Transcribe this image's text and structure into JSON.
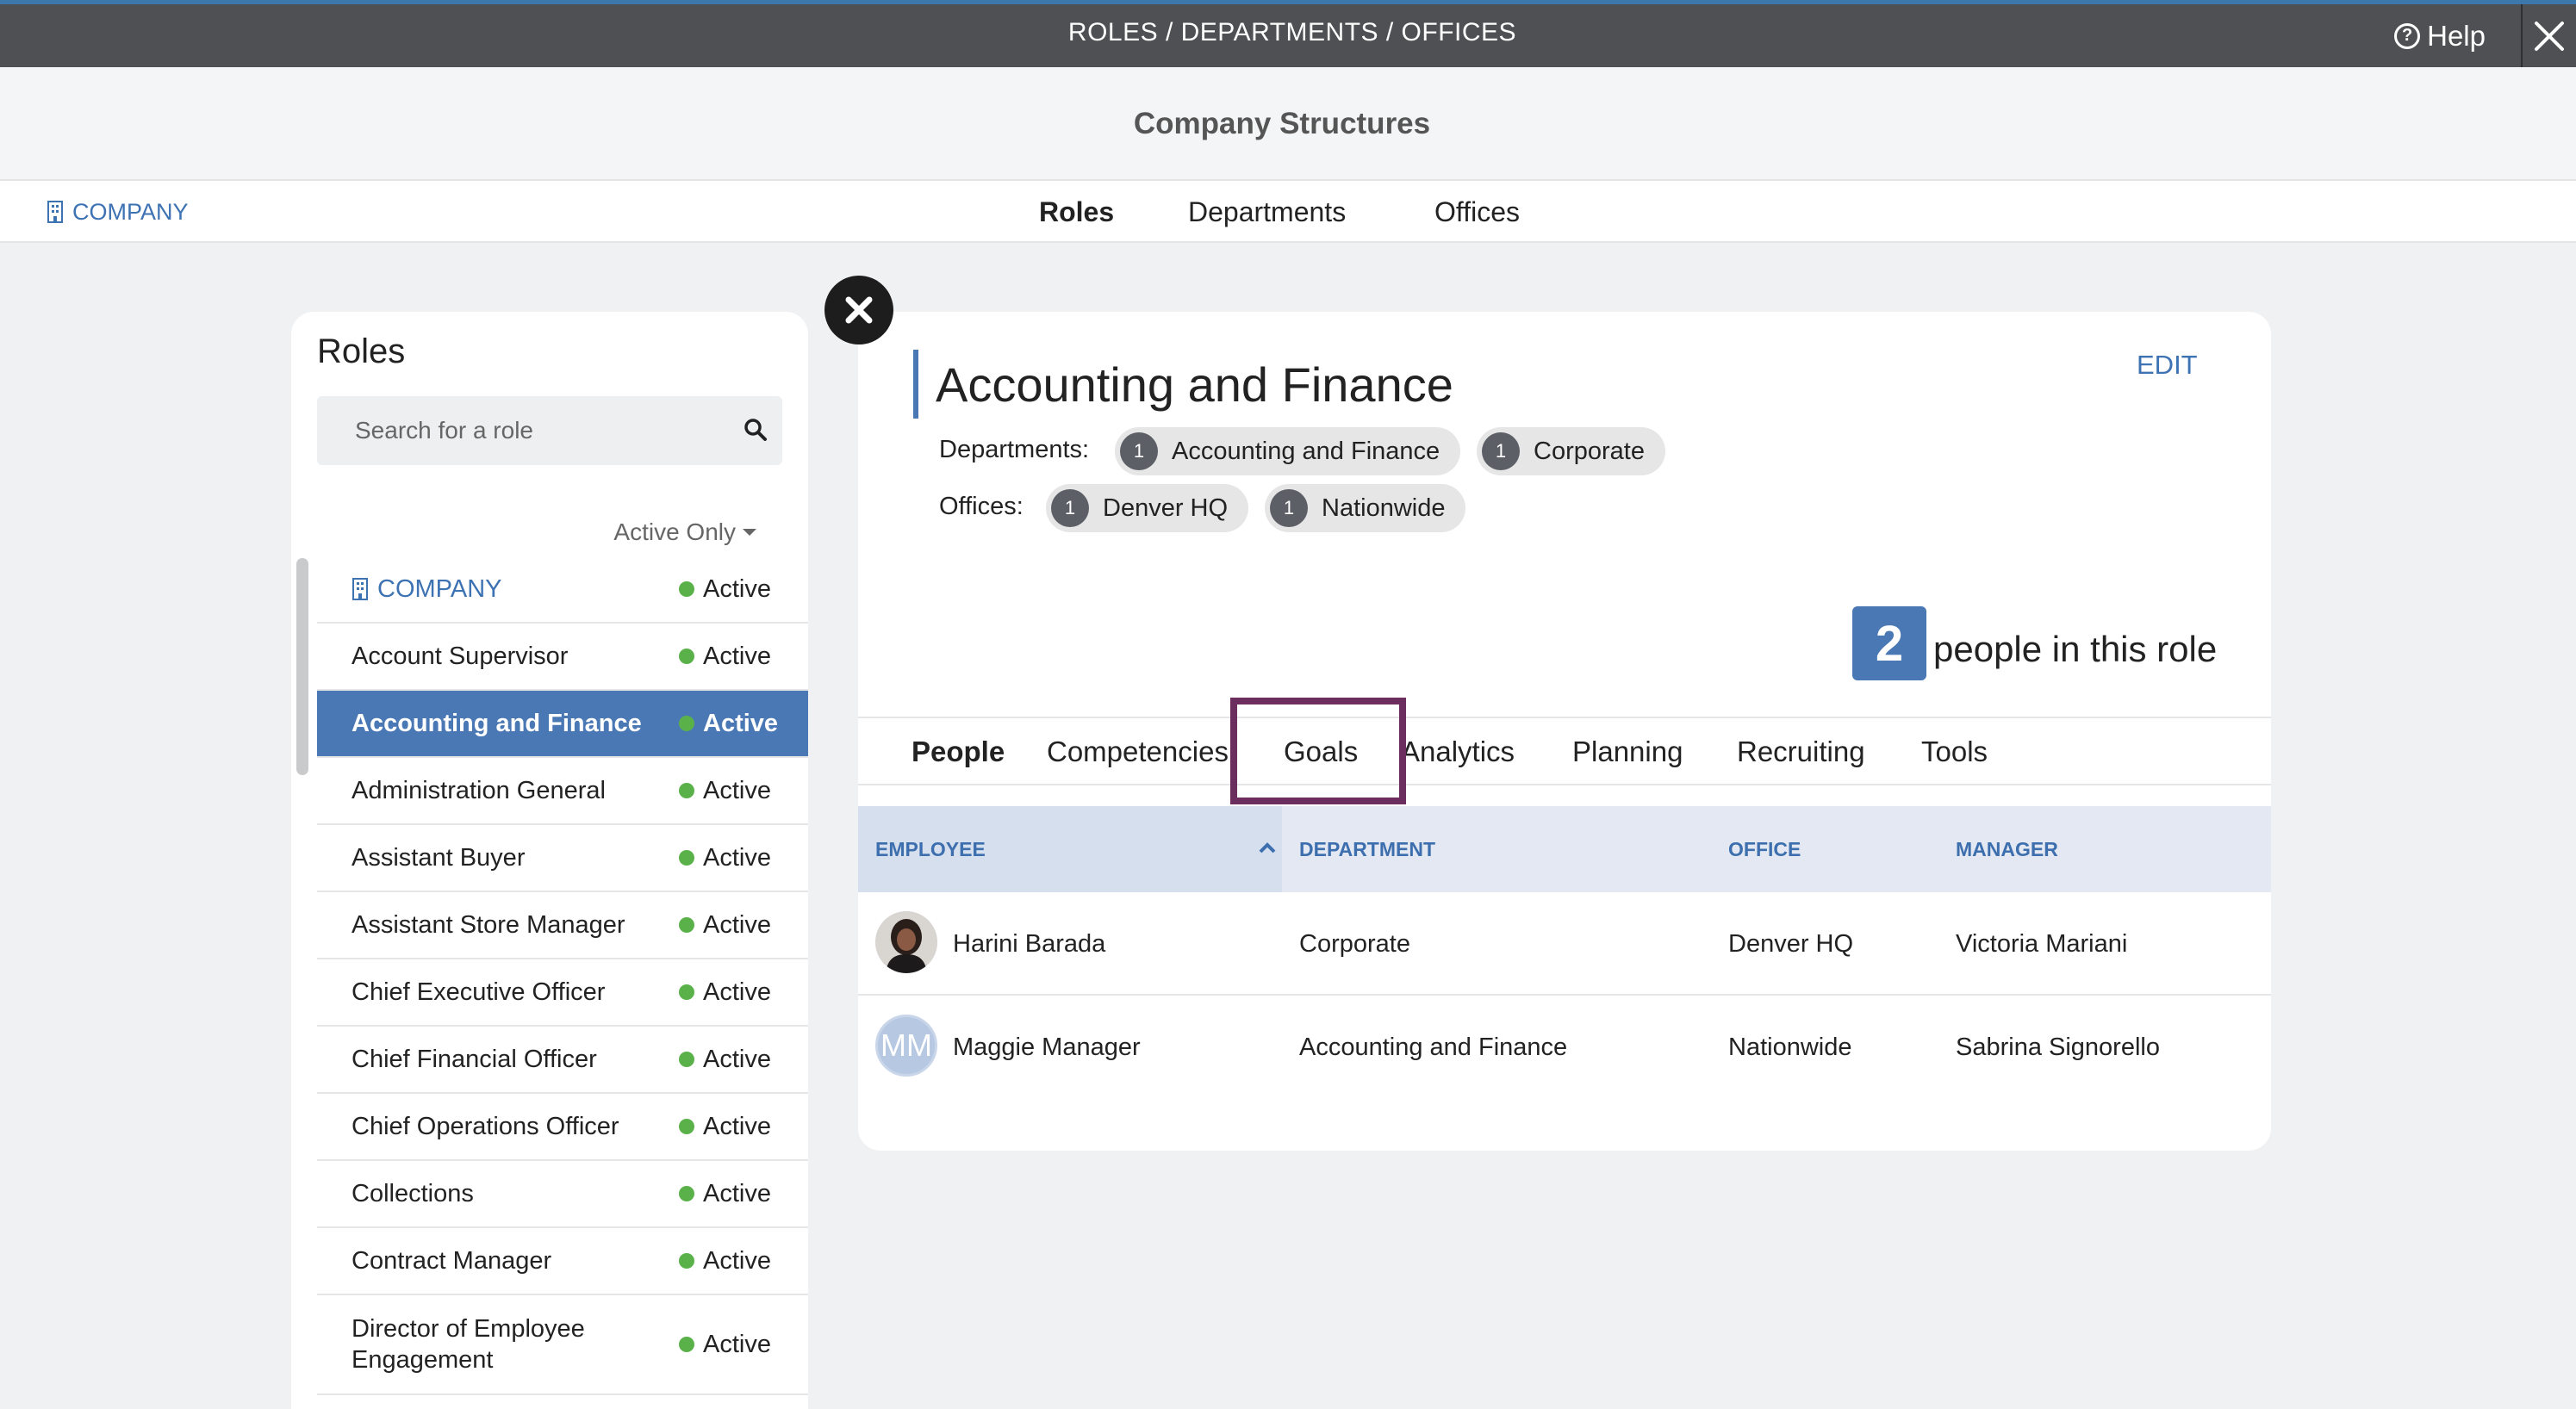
{
  "topbar": {
    "title": "ROLES / DEPARTMENTS / OFFICES",
    "help_label": "Help",
    "help_icon": "question-circle-icon",
    "close_icon": "close-icon"
  },
  "header": {
    "title": "Company Structures"
  },
  "nav": {
    "company_label": "COMPANY",
    "tabs": [
      {
        "label": "Roles",
        "active": true
      },
      {
        "label": "Departments",
        "active": false
      },
      {
        "label": "Offices",
        "active": false
      }
    ]
  },
  "roles_panel": {
    "title": "Roles",
    "search_placeholder": "Search for a role",
    "filter_label": "Active Only",
    "items": [
      {
        "name": "COMPANY",
        "status": "Active"
      },
      {
        "name": "Account Supervisor",
        "status": "Active"
      },
      {
        "name": "Accounting and Finance",
        "status": "Active",
        "selected": true
      },
      {
        "name": "Administration General",
        "status": "Active"
      },
      {
        "name": "Assistant Buyer",
        "status": "Active"
      },
      {
        "name": "Assistant Store Manager",
        "status": "Active"
      },
      {
        "name": "Chief Executive Officer",
        "status": "Active"
      },
      {
        "name": "Chief Financial Officer",
        "status": "Active"
      },
      {
        "name": "Chief Operations Officer",
        "status": "Active"
      },
      {
        "name": "Collections",
        "status": "Active"
      },
      {
        "name": "Contract Manager",
        "status": "Active"
      },
      {
        "name": "Director of Employee Engagement",
        "status": "Active"
      }
    ]
  },
  "detail": {
    "title": "Accounting and Finance",
    "edit_label": "EDIT",
    "departments_label": "Departments:",
    "departments": [
      {
        "count": "1",
        "name": "Accounting and Finance"
      },
      {
        "count": "1",
        "name": "Corporate"
      }
    ],
    "offices_label": "Offices:",
    "offices": [
      {
        "count": "1",
        "name": "Denver HQ"
      },
      {
        "count": "1",
        "name": "Nationwide"
      }
    ],
    "people_count": "2",
    "people_label": "people in this role",
    "tabs": [
      {
        "label": "People",
        "active": true
      },
      {
        "label": "Competencies"
      },
      {
        "label": "Goals",
        "highlighted": true
      },
      {
        "label": "Analytics"
      },
      {
        "label": "Planning"
      },
      {
        "label": "Recruiting"
      },
      {
        "label": "Tools"
      }
    ],
    "table": {
      "columns": [
        "EMPLOYEE",
        "DEPARTMENT",
        "OFFICE",
        "MANAGER"
      ],
      "rows": [
        {
          "avatar": "photo",
          "employee": "Harini Barada",
          "department": "Corporate",
          "office": "Denver HQ",
          "manager": "Victoria Mariani"
        },
        {
          "avatar": "MM",
          "employee": "Maggie Manager",
          "department": "Accounting and Finance",
          "office": "Nationwide",
          "manager": "Sabrina Signorello"
        }
      ]
    }
  },
  "colors": {
    "accent": "#4a78b5",
    "link": "#3d72b3",
    "status_active": "#5ab14a",
    "topbar": "#4f5053",
    "highlight": "#6b2e5f"
  }
}
